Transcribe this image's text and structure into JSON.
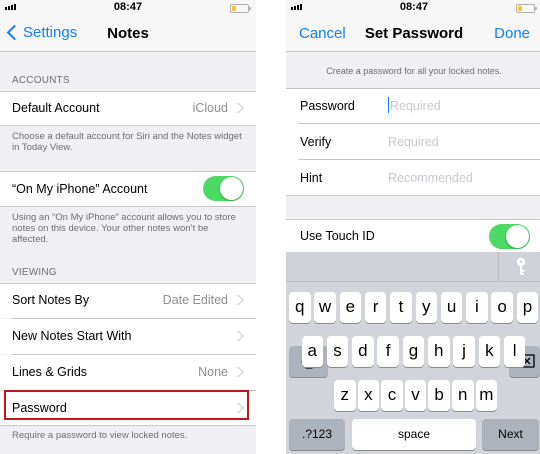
{
  "left": {
    "status": {
      "time": "08:47"
    },
    "nav": {
      "back_label": "Settings",
      "title": "Notes"
    },
    "accounts": {
      "header": "ACCOUNTS",
      "default_account": {
        "label": "Default Account",
        "value": "iCloud"
      },
      "default_footer": "Choose a default account for Siri and the Notes widget in Today View.",
      "on_my_iphone": {
        "label": "“On My iPhone” Account",
        "enabled": true
      },
      "on_my_iphone_footer": "Using an “On My iPhone” account allows you to store notes on this device. Your other notes won’t be affected."
    },
    "viewing": {
      "header": "VIEWING",
      "sort": {
        "label": "Sort Notes By",
        "value": "Date Edited"
      },
      "new_notes": {
        "label": "New Notes Start With"
      },
      "lines": {
        "label": "Lines & Grids",
        "value": "None"
      },
      "password": {
        "label": "Password"
      },
      "password_footer": "Require a password to view locked notes."
    },
    "highlight_color": "#c0161c"
  },
  "right": {
    "status": {
      "time": "08:47"
    },
    "nav": {
      "cancel_label": "Cancel",
      "title": "Set Password",
      "done_label": "Done"
    },
    "info": "Create a password for all your locked notes.",
    "fields": [
      {
        "label": "Password",
        "placeholder": "Required"
      },
      {
        "label": "Verify",
        "placeholder": "Required"
      },
      {
        "label": "Hint",
        "placeholder": "Recommended"
      }
    ],
    "touch_id": {
      "label": "Use Touch ID",
      "enabled": true
    },
    "keyboard": {
      "row1": [
        "q",
        "w",
        "e",
        "r",
        "t",
        "y",
        "u",
        "i",
        "o",
        "p"
      ],
      "row2": [
        "a",
        "s",
        "d",
        "f",
        "g",
        "h",
        "j",
        "k",
        "l"
      ],
      "row3": [
        "z",
        "x",
        "c",
        "v",
        "b",
        "n",
        "m"
      ],
      "numbers_label": ".?123",
      "space_label": "space",
      "next_label": "Next"
    }
  },
  "colors": {
    "accent": "#147efb",
    "toggle_on": "#4cd964",
    "battery": "#f5c52b"
  }
}
